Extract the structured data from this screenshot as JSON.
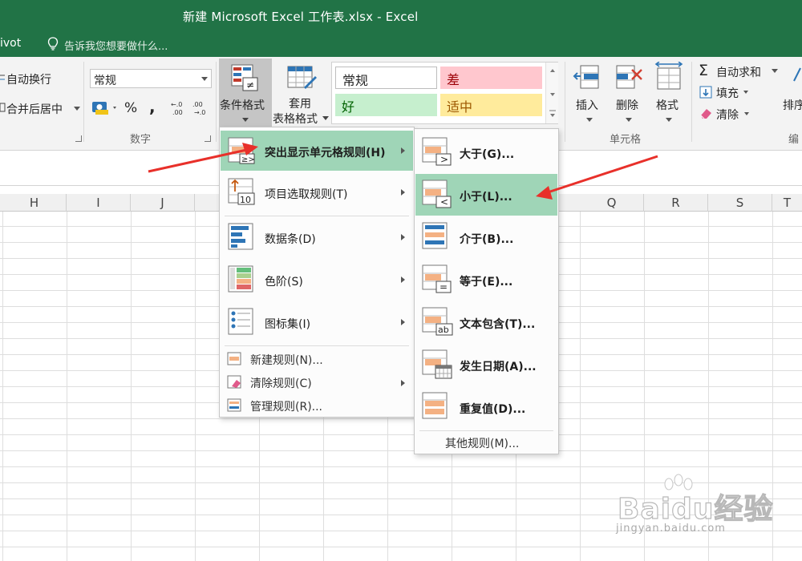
{
  "window": {
    "title": "新建 Microsoft Excel 工作表.xlsx - Excel"
  },
  "tellbar": {
    "tab_partial": "ivot",
    "tell_me": "告诉我您想要做什么..."
  },
  "ribbon": {
    "wrap_text": "自动换行",
    "merge_center": "合并后居中",
    "number_format": "常规",
    "percent": "%",
    "comma": ",",
    "number_group": "数字",
    "cond_format_line1": "条件格式",
    "table_format_line1": "套用",
    "table_format_line2": "表格格式",
    "styles": {
      "normal": "常规",
      "bad": "差",
      "good": "好",
      "neutral": "适中"
    },
    "insert": "插入",
    "delete": "删除",
    "format": "格式",
    "cells_group": "单元格",
    "autosum": "自动求和",
    "fill": "填充",
    "clear": "清除",
    "sort_partial": "排序",
    "editing_partial": "编"
  },
  "columns": [
    "H",
    "I",
    "J",
    "Q",
    "R",
    "S",
    "T"
  ],
  "menu": {
    "highlight_rules": "突出显示单元格规则(H)",
    "top_bottom": "项目选取规则(T)",
    "data_bars": "数据条(D)",
    "color_scales": "色阶(S)",
    "icon_sets": "图标集(I)",
    "new_rule": "新建规则(N)...",
    "clear_rules": "清除规则(C)",
    "manage_rules": "管理规则(R)..."
  },
  "submenu": {
    "greater": "大于(G)...",
    "less": "小于(L)...",
    "between": "介于(B)...",
    "equal": "等于(E)...",
    "text_contains": "文本包含(T)...",
    "date_occurring": "发生日期(A)...",
    "duplicate": "重复值(D)...",
    "more_rules": "其他规则(M)..."
  },
  "watermark": {
    "brand": "Baidu经验",
    "url": "jingyan.baidu.com"
  },
  "colors": {
    "excel_green": "#217346",
    "menu_highlight": "#9fd5b7",
    "arrow_red": "#e8302a"
  }
}
